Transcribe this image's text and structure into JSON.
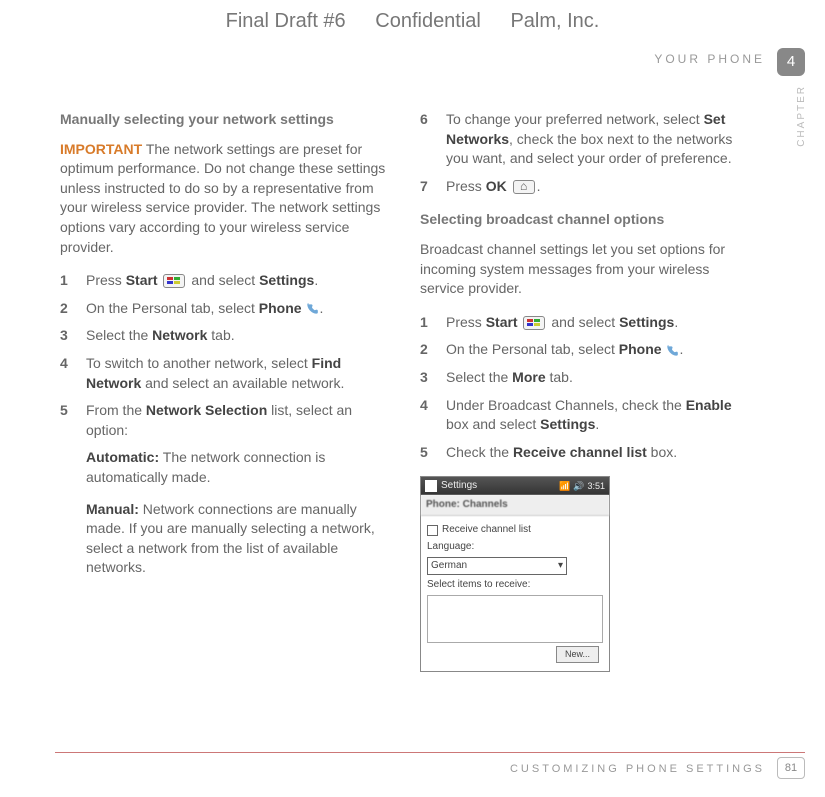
{
  "top_header": {
    "draft": "Final Draft #6",
    "conf": "Confidential",
    "company": "Palm, Inc."
  },
  "page_header": {
    "section": "YOUR PHONE",
    "chapter_num": "4",
    "chapter_word": "CHAPTER"
  },
  "left": {
    "heading": "Manually selecting your network settings",
    "important_label": "IMPORTANT",
    "important_text": " The network settings are preset for optimum performance. Do not change these settings unless instructed to do so by a representative from your wireless service provider. The network settings options vary according to your wireless service provider.",
    "s1a": "Press ",
    "s1b": "Start",
    "s1c": " and select ",
    "s1d": "Settings",
    "s1e": ".",
    "s2a": "On the Personal tab, select ",
    "s2b": "Phone",
    "s2c": ".",
    "s3a": "Select the ",
    "s3b": "Network",
    "s3c": " tab.",
    "s4a": "To switch to another network, select ",
    "s4b": "Find Network",
    "s4c": " and select an available network.",
    "s5a": "From the ",
    "s5b": "Network Selection",
    "s5c": " list, select an option:",
    "opt_auto_label": "Automatic:",
    "opt_auto_text": " The network connection is automatically made.",
    "opt_man_label": "Manual:",
    "opt_man_text": " Network connections are manually made. If you are manually selecting a network, select a network from the list of available networks."
  },
  "right": {
    "s6a": "To change your preferred network, select ",
    "s6b": "Set Networks",
    "s6c": ", check the box next to the networks you want, and select your order of preference.",
    "s7a": "Press ",
    "s7b": "OK",
    "s7c": ".",
    "heading2": "Selecting broadcast channel options",
    "para2": "Broadcast channel settings let you set options for incoming system messages from your wireless service provider.",
    "b1a": "Press ",
    "b1b": "Start",
    "b1c": " and select ",
    "b1d": "Settings",
    "b1e": ".",
    "b2a": "On the Personal tab, select ",
    "b2b": "Phone",
    "b2c": ".",
    "b3a": "Select the ",
    "b3b": "More",
    "b3c": " tab.",
    "b4a": "Under Broadcast Channels, check the ",
    "b4b": "Enable",
    "b4c": " box and select ",
    "b4d": "Settings",
    "b4e": ".",
    "b5a": "Check the ",
    "b5b": "Receive channel list",
    "b5c": " box."
  },
  "screenshot": {
    "title": "Settings",
    "time": "3:51",
    "section": "Phone: Channels",
    "receive_label": "Receive channel list",
    "language_label": "Language:",
    "language_value": "German",
    "select_label": "Select items to receive:",
    "new_btn": "New..."
  },
  "footer": {
    "section": "CUSTOMIZING PHONE SETTINGS",
    "page": "81"
  }
}
